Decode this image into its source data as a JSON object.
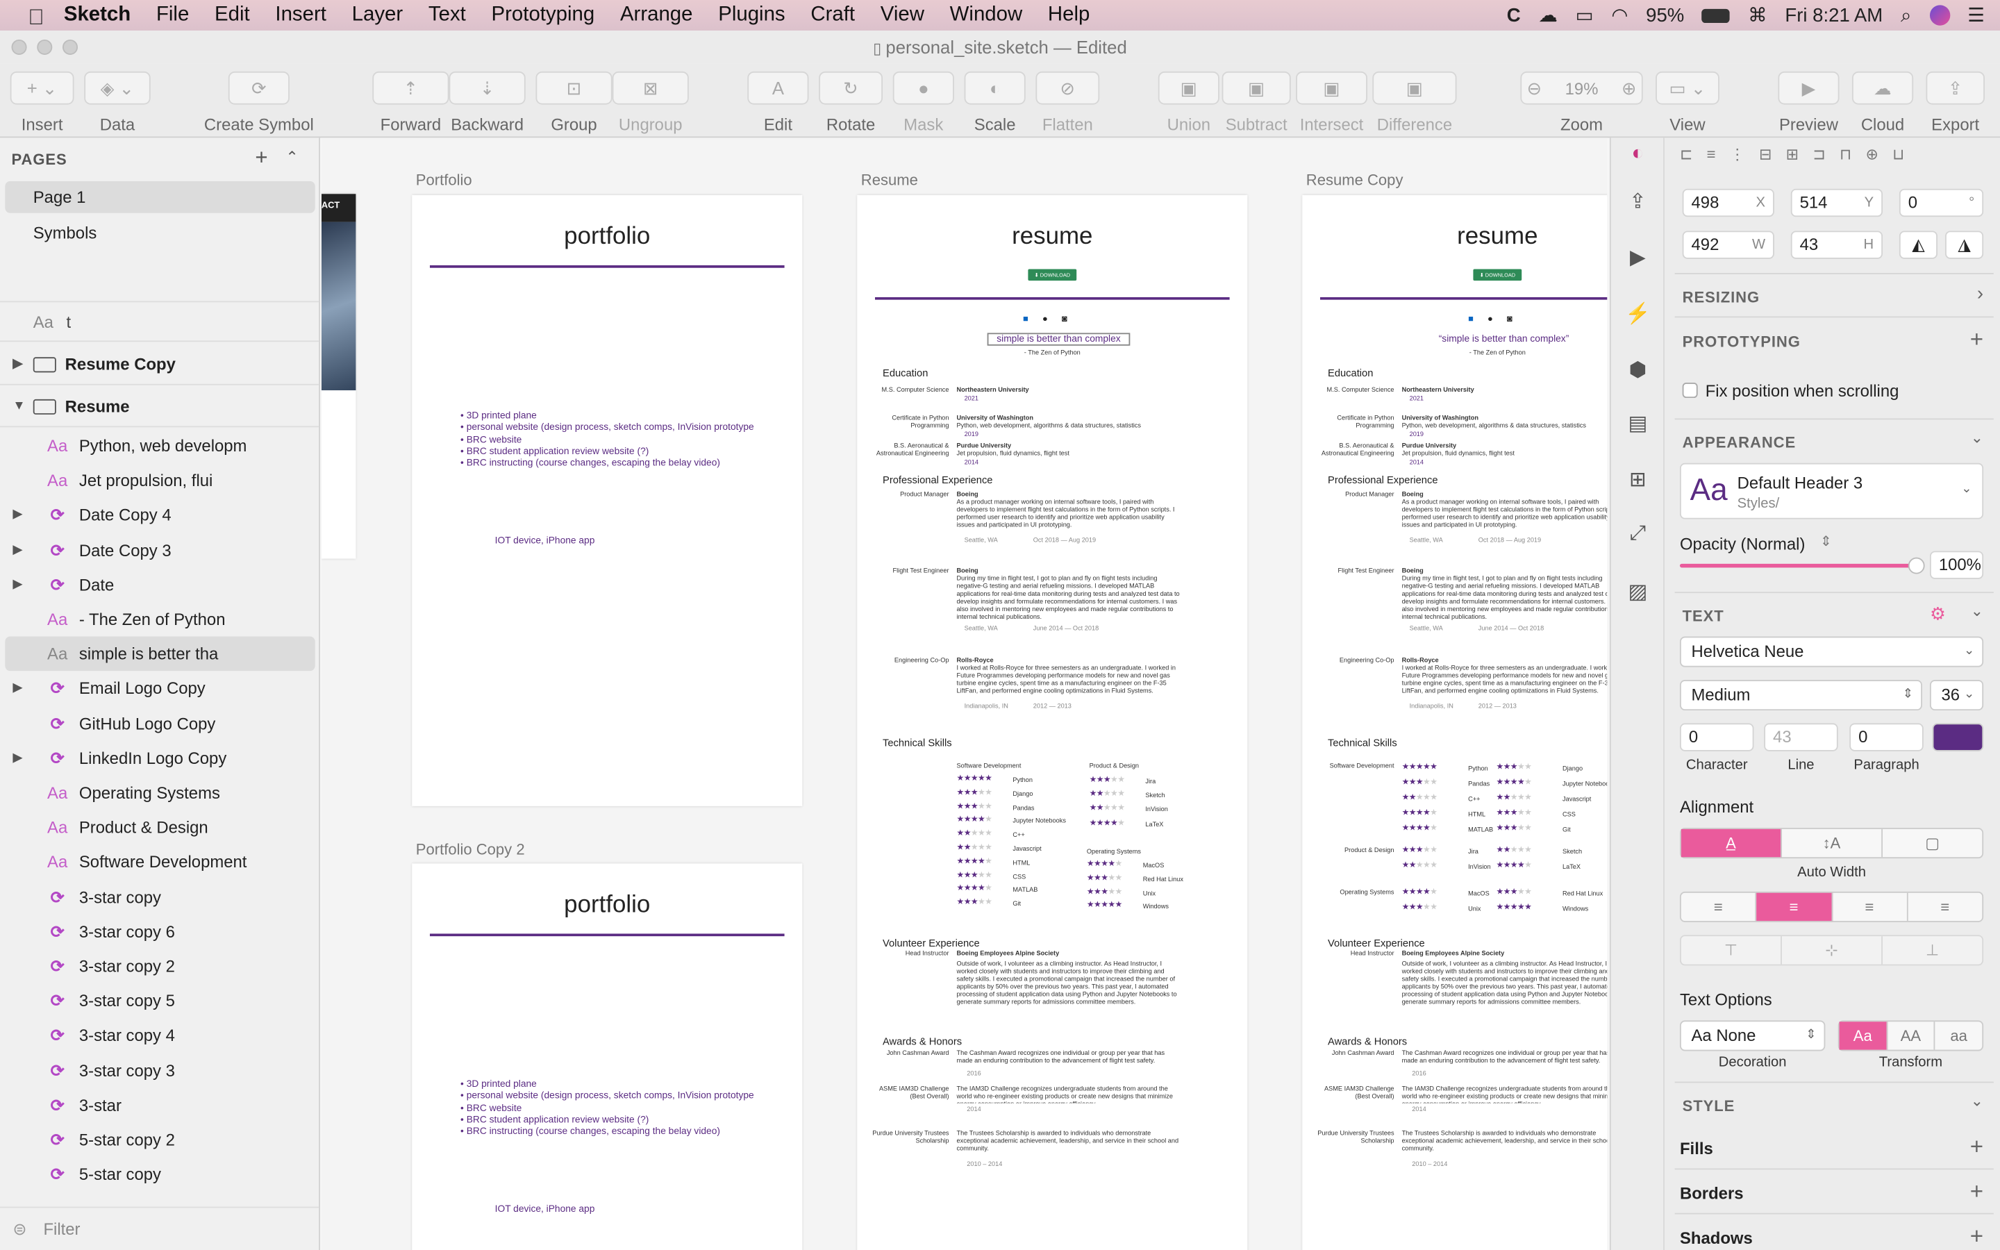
{
  "menubar": {
    "app": "Sketch",
    "items": [
      "File",
      "Edit",
      "Insert",
      "Layer",
      "Text",
      "Prototyping",
      "Arrange",
      "Plugins",
      "Craft",
      "View",
      "Window",
      "Help"
    ],
    "battery": "95%",
    "clock": "Fri 8:21 AM"
  },
  "window": {
    "title": "personal_site.sketch — Edited"
  },
  "toolbar": {
    "insert": "Insert",
    "data": "Data",
    "create_symbol": "Create Symbol",
    "forward": "Forward",
    "backward": "Backward",
    "group": "Group",
    "ungroup": "Ungroup",
    "edit": "Edit",
    "rotate": "Rotate",
    "mask": "Mask",
    "scale": "Scale",
    "flatten": "Flatten",
    "union": "Union",
    "subtract": "Subtract",
    "intersect": "Intersect",
    "difference": "Difference",
    "zoom_value": "19%",
    "zoom": "Zoom",
    "view": "View",
    "preview": "Preview",
    "cloud": "Cloud",
    "export": "Export"
  },
  "sidebar": {
    "pages_header": "PAGES",
    "pages": [
      "Page 1",
      "Symbols"
    ],
    "search_prefix": "Aa",
    "search_value": "t",
    "layers": [
      {
        "label": "Resume Copy",
        "type": "artboard"
      },
      {
        "label": "Resume",
        "type": "artboard"
      },
      {
        "label": "Python, web developm",
        "type": "text"
      },
      {
        "label": "Jet propulsion, flui",
        "type": "text"
      },
      {
        "label": "Date Copy 4",
        "type": "symbol"
      },
      {
        "label": "Date Copy 3",
        "type": "symbol"
      },
      {
        "label": "Date",
        "type": "symbol"
      },
      {
        "label": "- The Zen of Python",
        "type": "text"
      },
      {
        "label": "simple is better tha",
        "type": "text"
      },
      {
        "label": "Email Logo Copy",
        "type": "symbol"
      },
      {
        "label": "GitHub Logo Copy",
        "type": "symbol"
      },
      {
        "label": "LinkedIn Logo Copy",
        "type": "symbol"
      },
      {
        "label": "Operating Systems",
        "type": "text"
      },
      {
        "label": "Product & Design",
        "type": "text"
      },
      {
        "label": "Software Development",
        "type": "text"
      },
      {
        "label": "3-star copy",
        "type": "symbol"
      },
      {
        "label": "3-star copy 6",
        "type": "symbol"
      },
      {
        "label": "3-star copy 2",
        "type": "symbol"
      },
      {
        "label": "3-star copy 5",
        "type": "symbol"
      },
      {
        "label": "3-star copy 4",
        "type": "symbol"
      },
      {
        "label": "3-star copy 3",
        "type": "symbol"
      },
      {
        "label": "3-star",
        "type": "symbol"
      },
      {
        "label": "5-star copy 2",
        "type": "symbol"
      },
      {
        "label": "5-star copy",
        "type": "symbol"
      }
    ],
    "filter_placeholder": "Filter"
  },
  "canvas": {
    "partial_label": "ACT",
    "portfolio": {
      "label": "Portfolio",
      "title": "portfolio",
      "bullets": [
        "• 3D printed plane",
        "• personal website (design process, sketch comps, InVision prototype",
        "• BRC website",
        "• BRC student application review website (?)",
        "• BRC instructing (course changes, escaping the belay video)"
      ],
      "iot": "IOT device, iPhone app"
    },
    "portfolio2": {
      "label": "Portfolio Copy 2",
      "title": "portfolio"
    },
    "resume": {
      "label": "Resume",
      "title": "resume",
      "download": "⬇ DOWNLOAD",
      "quote": "simple is better than complex",
      "quote_copy": "“simple is better than complex”",
      "zen": "- The Zen of Python",
      "education": "Education",
      "edu": [
        {
          "deg": "M.S. Computer Science",
          "school": "Northeastern University",
          "detail": "",
          "year": "2021"
        },
        {
          "deg": "Certificate in Python Programming",
          "school": "University of Washington",
          "detail": "Python, web development, algorithms & data structures, statistics",
          "year": "2019"
        },
        {
          "deg": "B.S. Aeronautical & Astronautical Engineering",
          "school": "Purdue University",
          "detail": "Jet propulsion, fluid dynamics, flight test",
          "year": "2014"
        }
      ],
      "prof": "Professional Experience",
      "jobs": [
        {
          "role": "Product Manager",
          "co": "Boeing",
          "desc": "As a product manager working on internal software tools, I paired with developers to implement flight test calculations in the form of Python scripts. I performed user research to identify and prioritize web application usability issues and participated in UI prototyping.",
          "loc": "Seattle, WA",
          "dates": "Oct 2018 — Aug 2019"
        },
        {
          "role": "Flight Test Engineer",
          "co": "Boeing",
          "desc": "During my time in flight test, I got to plan and fly on flight tests including negative-G testing and aerial refueling missions. I developed MATLAB applications for real-time data monitoring during tests and analyzed test data to develop insights and formulate recommendations for internal customers. I was also involved in mentoring new employees and made regular contributions to internal technical publications.",
          "loc": "Seattle, WA",
          "dates": "June 2014 — Oct 2018"
        },
        {
          "role": "Engineering Co-Op",
          "co": "Rolls-Royce",
          "desc": "I worked at Rolls-Royce for three semesters as an undergraduate. I worked in Future Programmes developing performance models for new and novel gas turbine engine cycles, spent time as a manufacturing engineer on the F-35 LiftFan, and performed engine cooling optimizations in Fluid Systems.",
          "loc": "Indianapolis, IN",
          "dates": "2012 — 2013"
        }
      ],
      "tech": "Technical Skills",
      "sw_head": "Software Development",
      "pd_head": "Product & Design",
      "os_head": "Operating Systems",
      "sw": [
        {
          "name": "Python",
          "stars": 5
        },
        {
          "name": "Django",
          "stars": 3
        },
        {
          "name": "Pandas",
          "stars": 3
        },
        {
          "name": "Jupyter Notebooks",
          "stars": 4
        },
        {
          "name": "C++",
          "stars": 2
        },
        {
          "name": "Javascript",
          "stars": 2
        },
        {
          "name": "HTML",
          "stars": 4
        },
        {
          "name": "CSS",
          "stars": 3
        },
        {
          "name": "MATLAB",
          "stars": 4
        },
        {
          "name": "Git",
          "stars": 3
        }
      ],
      "pd": [
        {
          "name": "Jira",
          "stars": 3
        },
        {
          "name": "Sketch",
          "stars": 2
        },
        {
          "name": "InVision",
          "stars": 2
        },
        {
          "name": "LaTeX",
          "stars": 4
        }
      ],
      "os": [
        {
          "name": "MacOS",
          "stars": 4
        },
        {
          "name": "Red Hat Linux",
          "stars": 3
        },
        {
          "name": "Unix",
          "stars": 3
        },
        {
          "name": "Windows",
          "stars": 5
        }
      ],
      "vol": "Volunteer Experience",
      "vol_role": "Head Instructor",
      "vol_org": "Boeing Employees Alpine Society",
      "vol_desc": "Outside of work, I volunteer as a climbing instructor. As Head Instructor, I worked closely with students and instructors to improve their climbing and safety skills. I executed a promotional campaign that increased the number of applicants by 50% over the previous two years. This past year, I automated processing of student application data using Python and Jupyter Notebooks to generate summary reports for admissions committee members.",
      "awards": "Awards & Honors",
      "aw": [
        {
          "name": "John Cashman Award",
          "desc": "The Cashman Award recognizes one individual or group per year that has made an enduring contribution to the advancement of flight test safety.",
          "year": "2016"
        },
        {
          "name": "ASME IAM3D Challenge (Best Overall)",
          "desc": "The IAM3D Challenge recognizes undergraduate students from around the world who re-engineer existing products or create new designs that minimize energy consumption or improve energy efficiency.",
          "year": "2014"
        },
        {
          "name": "Purdue University Trustees Scholarship",
          "desc": "The Trustees Scholarship is awarded to individuals who demonstrate exceptional academic achievement, leadership, and service in their school and community.",
          "year": "2010 – 2014"
        }
      ]
    },
    "resume_copy": {
      "label": "Resume Copy",
      "title": "resume"
    }
  },
  "inspector": {
    "x": "498",
    "x_suf": "X",
    "y": "514",
    "y_suf": "Y",
    "rot": "0",
    "rot_suf": "°",
    "w": "492",
    "w_suf": "W",
    "h": "43",
    "h_suf": "H",
    "resizing": "RESIZING",
    "prototyping": "PROTOTYPING",
    "fix_pos": "Fix position when scrolling",
    "appearance": "APPEARANCE",
    "style_icon": "Aa",
    "style_name": "Default Header 3",
    "style_path": "Styles/",
    "opacity_label": "Opacity (Normal)",
    "opacity_value": "100%",
    "opacity_fraction": 1.0,
    "text_header": "TEXT",
    "font": "Helvetica Neue",
    "weight": "Medium",
    "size": "36",
    "character": "0",
    "line": "43",
    "paragraph": "0",
    "text_color": "#5b2c83",
    "char_label": "Character",
    "line_label": "Line",
    "para_label": "Paragraph",
    "alignment": "Alignment",
    "auto_width": "Auto Width",
    "text_options": "Text Options",
    "decoration_value": "Aa None",
    "decoration": "Decoration",
    "transform": "Transform",
    "transform_opts": [
      "Aa",
      "AA",
      "aa"
    ],
    "style": "STYLE",
    "fills": "Fills",
    "borders": "Borders",
    "shadows": "Shadows",
    "accent": "#ea5b9c"
  }
}
